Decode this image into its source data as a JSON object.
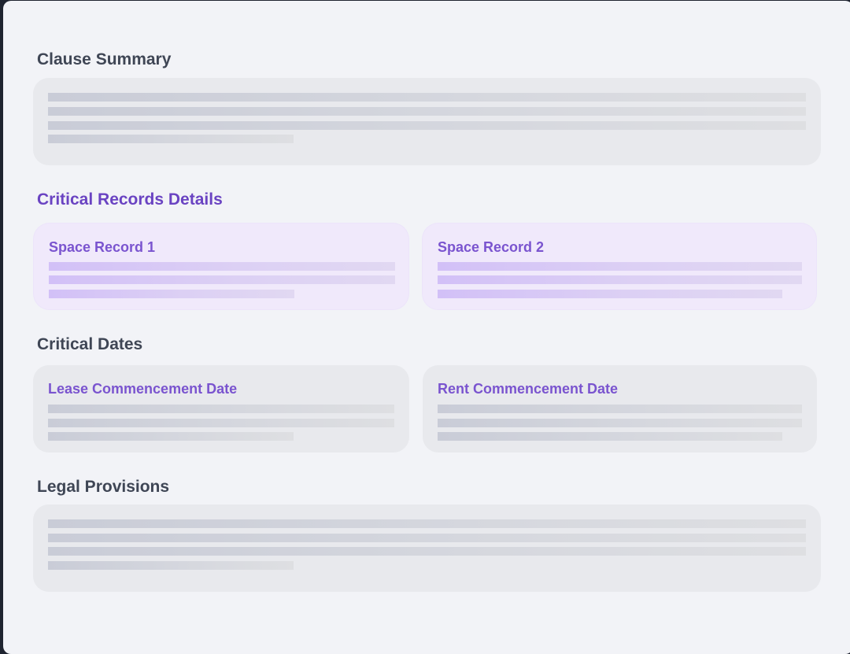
{
  "sections": {
    "clause_summary": {
      "title": "Clause Summary"
    },
    "critical_records": {
      "title": "Critical Records Details",
      "cards": [
        {
          "title": "Space Record 1"
        },
        {
          "title": "Space Record 2"
        }
      ]
    },
    "critical_dates": {
      "title": "Critical Dates",
      "cards": [
        {
          "title": "Lease Commencement Date"
        },
        {
          "title": "Rent Commencement Date"
        }
      ]
    },
    "legal_provisions": {
      "title": "Legal Provisions"
    }
  },
  "colors": {
    "panel_background": "#f2f3f7",
    "accent_purple": "#6a43c2",
    "card_title_purple": "#7a54cf",
    "heading_gray": "#3f4655",
    "skeleton_gray": "#c9ccd7",
    "skeleton_purple": "#d2c0f7"
  }
}
